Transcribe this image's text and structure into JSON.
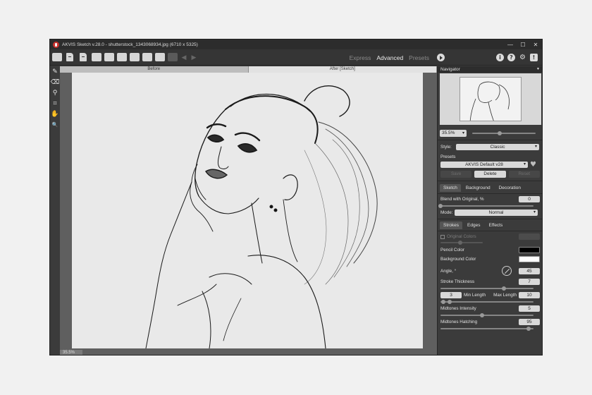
{
  "window": {
    "title": "AKVIS Sketch v.28.0 - shutterstock_1343068934.jpg (6710 x 5325)",
    "controls": [
      "—",
      "☐",
      "✕"
    ]
  },
  "toolbar": {
    "modes": [
      {
        "label": "Express",
        "active": false
      },
      {
        "label": "Advanced",
        "active": true
      },
      {
        "label": "Presets",
        "active": false
      }
    ],
    "right_icons": [
      "i",
      "?",
      "⚙",
      "!"
    ]
  },
  "tools": [
    "✎",
    "⌫",
    "⚲",
    "⌗",
    "✋",
    "🔍"
  ],
  "canvas": {
    "tabs": [
      {
        "label": "Before",
        "active": false
      },
      {
        "label": "After [Sketch]",
        "active": true
      }
    ],
    "zoom_badge": "35.5%"
  },
  "panel": {
    "navigator_title": "Navigator",
    "zoom_value": "35.5%",
    "zoom_slider": 0.43,
    "style_label": "Style:",
    "style_value": "Classic",
    "presets_label": "Presets",
    "preset_value": "AKVIS Default v28",
    "preset_buttons": {
      "save": "Save",
      "delete": "Delete",
      "reset": "Reset"
    },
    "main_tabs": [
      {
        "label": "Sketch",
        "active": true
      },
      {
        "label": "Background",
        "active": false
      },
      {
        "label": "Decoration",
        "active": false
      }
    ],
    "blend_label": "Blend with Original, %",
    "blend_value": "0",
    "mode_label": "Mode:",
    "mode_value": "Normal",
    "sub_tabs": [
      {
        "label": "Strokes",
        "active": true
      },
      {
        "label": "Edges",
        "active": false
      },
      {
        "label": "Effects",
        "active": false
      }
    ],
    "original_colors_label": "Original Colors",
    "original_colors_value": "75",
    "pencil_color_label": "Pencil Color",
    "pencil_color": "#000000",
    "background_color_label": "Background Color",
    "background_color": "#ffffff",
    "angle_label": "Angle, °",
    "angle_value": "45",
    "stroke_thickness_label": "Stroke Thickness",
    "stroke_thickness_value": "7",
    "stroke_thickness_slider": 0.68,
    "min_length_value": "3",
    "min_length_label": "Min Length",
    "max_length_label": "Max Length",
    "max_length_value": "10",
    "midtones_intensity_label": "Midtones Intensity",
    "midtones_intensity_value": "5",
    "midtones_intensity_slider": 0.45,
    "midtones_hatching_label": "Midtones Hatching",
    "midtones_hatching_value": "95",
    "midtones_hatching_slider": 0.95
  }
}
